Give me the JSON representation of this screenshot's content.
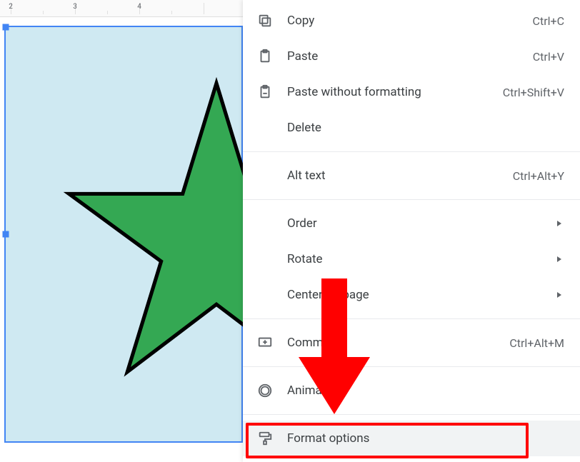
{
  "ruler": {
    "labels": [
      "2",
      "3",
      "4"
    ]
  },
  "shape": {
    "kind": "star",
    "fill": "#34a853",
    "stroke": "#000000"
  },
  "menu": {
    "items": [
      {
        "id": "copy",
        "icon": "copy-icon",
        "label": "Copy",
        "shortcut": "Ctrl+C"
      },
      {
        "id": "paste",
        "icon": "paste-icon",
        "label": "Paste",
        "shortcut": "Ctrl+V"
      },
      {
        "id": "paste-nf",
        "icon": "paste-plain-icon",
        "label": "Paste without formatting",
        "shortcut": "Ctrl+Shift+V"
      },
      {
        "id": "delete",
        "icon": null,
        "label": "Delete"
      },
      {
        "sep": true
      },
      {
        "id": "alt-text",
        "icon": null,
        "label": "Alt text",
        "shortcut": "Ctrl+Alt+Y"
      },
      {
        "sep": true
      },
      {
        "id": "order",
        "icon": null,
        "label": "Order",
        "submenu": true
      },
      {
        "id": "rotate",
        "icon": null,
        "label": "Rotate",
        "submenu": true
      },
      {
        "id": "center",
        "icon": null,
        "label": "Center on page",
        "submenu": true
      },
      {
        "sep": true
      },
      {
        "id": "comment",
        "icon": "comment-icon",
        "label": "Comment",
        "shortcut": "Ctrl+Alt+M"
      },
      {
        "sep": true
      },
      {
        "id": "animate",
        "icon": "animate-icon",
        "label": "Animate"
      },
      {
        "sep": true
      },
      {
        "id": "format-options",
        "icon": "paint-roller-icon",
        "label": "Format options",
        "highlighted": true
      }
    ]
  },
  "annotation": {
    "arrow_color": "#ff0000"
  }
}
